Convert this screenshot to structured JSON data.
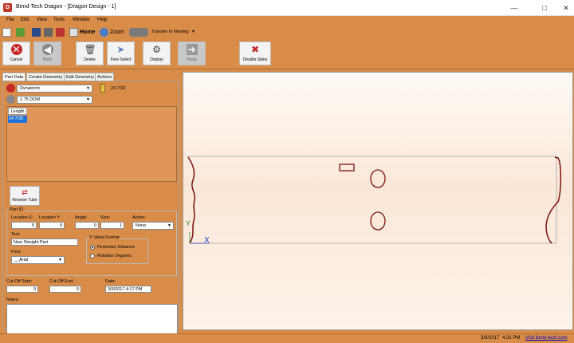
{
  "window": {
    "title": "Bend-Tech Dragon - [Dragon Design - 1]",
    "app_icon": "dragon-logo-icon"
  },
  "menubar": [
    "File",
    "Edit",
    "View",
    "Tools",
    "Window",
    "Help"
  ],
  "quickbar": {
    "home_label": "Home",
    "zoom_label": "Zoom",
    "transfer_label": "Transfer to Nesting"
  },
  "toolbar": {
    "cancel": "Cancel",
    "back": "Back",
    "delete": "Delete",
    "free_select": "Free Select",
    "display": "Display",
    "paste": "Paste",
    "disable_sides": "Disable Sides"
  },
  "tabs": [
    "Part Data",
    "Create Geometry",
    "Edit Geometry",
    "Actions"
  ],
  "part_data": {
    "machine": "Dynatorch",
    "material": "1.75 DOM",
    "length_display": "24 7/32",
    "length_table": {
      "header": "Length",
      "rows": [
        "24 7/32"
      ]
    },
    "reverse_tube": "Reverse Tube",
    "part_id": {
      "group_label": "Part ID",
      "location_x_label": "Location X:",
      "location_x": "5",
      "location_y_label": "Location Y:",
      "location_y": "0",
      "angle_label": "Angle:",
      "angle": "0",
      "size_label": "Size:",
      "size": "1",
      "action_label": "Action:",
      "action": "None",
      "text_label": "Text:",
      "text": "New Straight Part",
      "font_label": "Font:",
      "font": "__Arial",
      "y_format_label": "Y Value Format",
      "y_format_options": [
        "Perimeter Distance",
        "Rotation Degrees"
      ],
      "y_format_selected": 0
    },
    "cutoff_start_label": "Cut-Off Start:",
    "cutoff_start": "0",
    "cutoff_end_label": "Cut-Off End:",
    "cutoff_end": "0",
    "date_label": "Date:",
    "date": "3/9/2017 4:17 PM",
    "notes_label": "Notes:"
  },
  "canvas": {
    "axis_y": "Y",
    "axis_x": "X",
    "axis_y_color": "#2a8a2a",
    "axis_x_color": "#1a3ccc",
    "geometry_color": "#7a1010"
  },
  "status": {
    "date": "3/9/2017",
    "time": "4:31 PM",
    "link": "Visit bend-tech.com"
  }
}
